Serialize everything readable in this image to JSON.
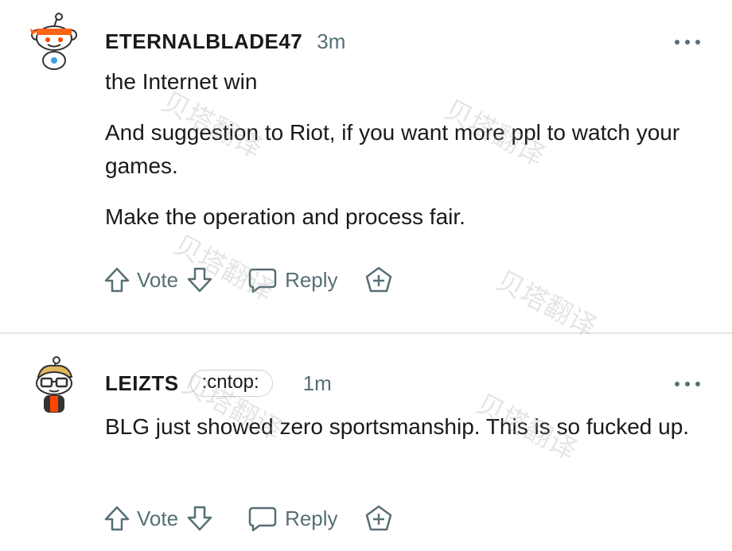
{
  "comments": [
    {
      "username": "ETERNALBLADE47",
      "time": "3m",
      "paragraphs": [
        "the Internet win",
        "And suggestion to Riot, if you want more ppl to watch your games.",
        "Make the operation and process fair."
      ],
      "vote_label": "Vote",
      "reply_label": "Reply"
    },
    {
      "username": "LEIZTS",
      "flair": ":cntop:",
      "time": "1m",
      "paragraphs": [
        "BLG just showed zero sportsmanship. This is so fucked up."
      ],
      "vote_label": "Vote",
      "reply_label": "Reply"
    }
  ],
  "watermark": "贝塔翻译",
  "colors": {
    "text": "#1a1a1b",
    "meta": "#576f76",
    "divider": "#e6e6e6",
    "avatar1_accent": "#ff6314",
    "avatar2_shirt": "#ff4500"
  },
  "icons": {
    "upvote": "arrow-up-outline-icon",
    "downvote": "arrow-down-outline-icon",
    "reply": "speech-bubble-icon",
    "award": "award-plus-icon",
    "more": "ellipsis-icon"
  }
}
